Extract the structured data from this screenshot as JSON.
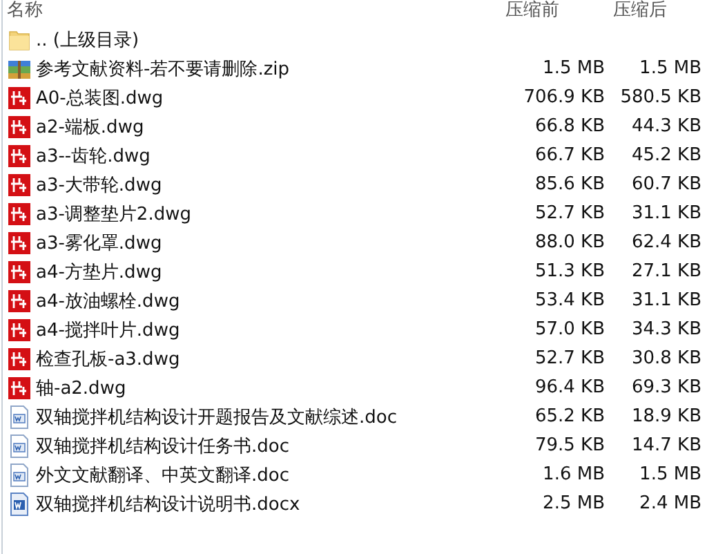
{
  "columns": [
    "名称",
    "压缩前",
    "压缩后"
  ],
  "rows": [
    {
      "kind": "folder",
      "name": ".. (上级目录)"
    },
    {
      "kind": "zip",
      "name": "参考文献资料-若不要请删除.zip",
      "size": "1.5 MB",
      "packed": "1.5 MB"
    },
    {
      "kind": "dwg",
      "name": "A0-总装图.dwg",
      "size": "706.9 KB",
      "packed": "580.5 KB"
    },
    {
      "kind": "dwg",
      "name": "a2-端板.dwg",
      "size": "66.8 KB",
      "packed": "44.3 KB"
    },
    {
      "kind": "dwg",
      "name": "a3--齿轮.dwg",
      "size": "66.7 KB",
      "packed": "45.2 KB"
    },
    {
      "kind": "dwg",
      "name": "a3-大带轮.dwg",
      "size": "85.6 KB",
      "packed": "60.7 KB"
    },
    {
      "kind": "dwg",
      "name": "a3-调整垫片2.dwg",
      "size": "52.7 KB",
      "packed": "31.1 KB"
    },
    {
      "kind": "dwg",
      "name": "a3-雾化罩.dwg",
      "size": "88.0 KB",
      "packed": "62.4 KB"
    },
    {
      "kind": "dwg",
      "name": "a4-方垫片.dwg",
      "size": "51.3 KB",
      "packed": "27.1 KB"
    },
    {
      "kind": "dwg",
      "name": "a4-放油螺栓.dwg",
      "size": "53.4 KB",
      "packed": "31.1 KB"
    },
    {
      "kind": "dwg",
      "name": "a4-搅拌叶片.dwg",
      "size": "57.0 KB",
      "packed": "34.3 KB"
    },
    {
      "kind": "dwg",
      "name": "检查孔板-a3.dwg",
      "size": "52.7 KB",
      "packed": "30.8 KB"
    },
    {
      "kind": "dwg",
      "name": "轴-a2.dwg",
      "size": "96.4 KB",
      "packed": "69.3 KB"
    },
    {
      "kind": "doc",
      "name": "双轴搅拌机结构设计开题报告及文献综述.doc",
      "size": "65.2 KB",
      "packed": "18.9 KB"
    },
    {
      "kind": "doc",
      "name": "双轴搅拌机结构设计任务书.doc",
      "size": "79.5 KB",
      "packed": "14.7 KB"
    },
    {
      "kind": "doc",
      "name": "外文文献翻译、中英文翻译.doc",
      "size": "1.6 MB",
      "packed": "1.5 MB"
    },
    {
      "kind": "docx",
      "name": "双轴搅拌机结构设计说明书.docx",
      "size": "2.5 MB",
      "packed": "2.4 MB"
    }
  ]
}
